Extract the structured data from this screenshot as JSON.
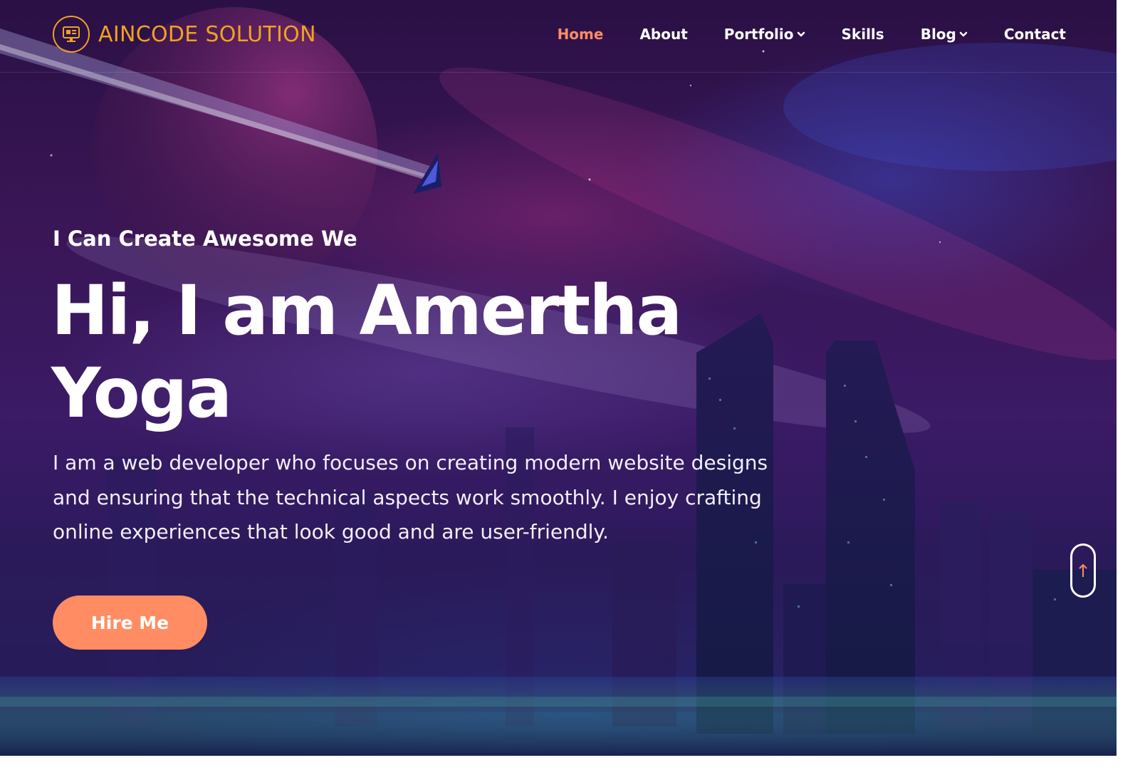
{
  "brand": {
    "name": "AINCODE SOLUTION",
    "logo_icon": "monitor-icon",
    "color": "#f0a21f"
  },
  "nav": {
    "items": [
      {
        "label": "Home",
        "active": true
      },
      {
        "label": "About"
      },
      {
        "label": "Portfolio",
        "icon": "chevron-down-icon"
      },
      {
        "label": "Skills"
      },
      {
        "label": "Blog",
        "icon": "chevron-down-icon"
      },
      {
        "label": "Contact"
      }
    ],
    "active_color": "#ff8c66"
  },
  "hero": {
    "eyebrow": "I Can Create Awesome We",
    "title_line1": "Hi, I am Amertha",
    "title_line2": "Yoga",
    "description": "I am a web developer who focuses on creating modern website designs and ensuring that the technical aspects work smoothly. I enjoy crafting online experiences that look good and are user-friendly.",
    "cta_label": "Hire Me",
    "cta_color": "#ff8c63"
  },
  "scroll_top": {
    "icon": "arrow-up-icon"
  }
}
